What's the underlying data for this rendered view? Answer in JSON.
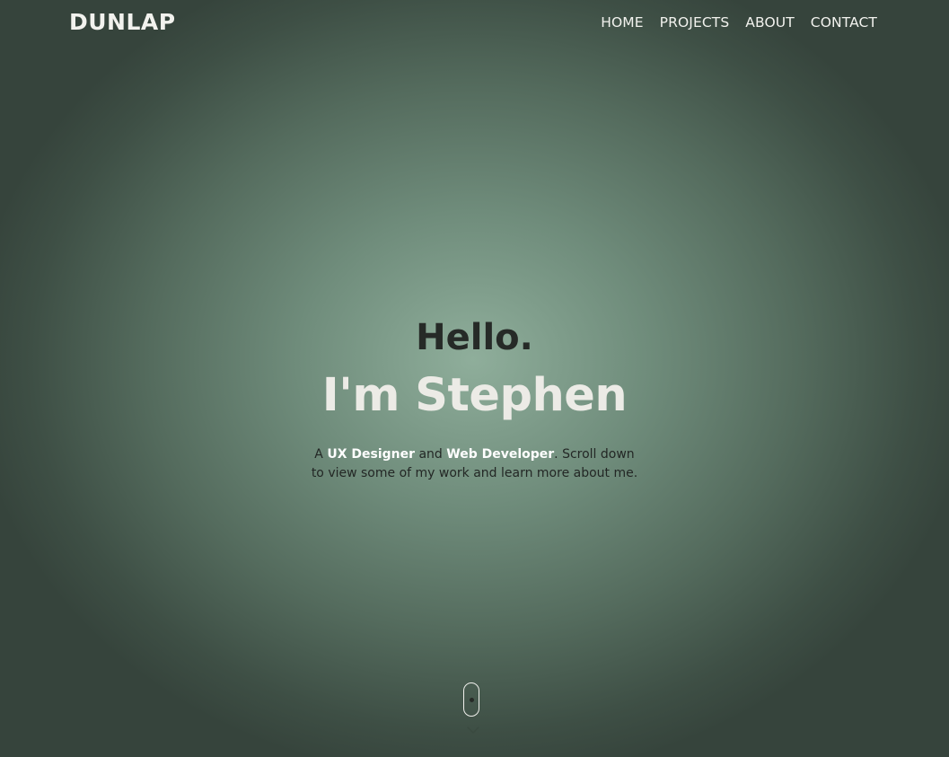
{
  "header": {
    "logo": "DUNLAP",
    "nav": [
      {
        "label": "HOME"
      },
      {
        "label": "PROJECTS"
      },
      {
        "label": "ABOUT"
      },
      {
        "label": "CONTACT"
      }
    ]
  },
  "hero": {
    "greeting": "Hello.",
    "name": "I'm Stephen",
    "intro": {
      "prefix": "A ",
      "role1": "UX Designer",
      "and": " and ",
      "role2": "Web Developer",
      "suffix_line1": ". Scroll down",
      "suffix_line2": "to view some of my work and learn more about me."
    }
  },
  "scroll": {
    "icon": "mouse-scroll-icon",
    "arrow_icon": "chevron-down-icon"
  },
  "colors": {
    "bg_center": "#8fae9b",
    "bg_edge": "#36443c",
    "text_light": "#f2f2ee",
    "text_dark": "#262a27",
    "accent_white": "#ffffff"
  }
}
